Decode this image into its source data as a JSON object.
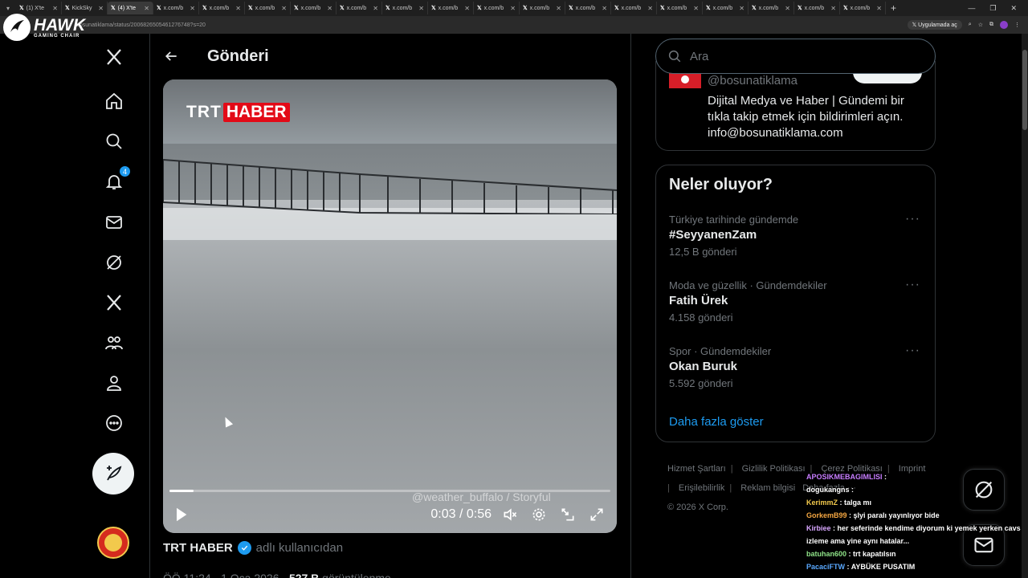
{
  "browser": {
    "tabs": [
      {
        "label": "(1) X'te"
      },
      {
        "label": "KickSky"
      },
      {
        "label": "(4) X'te",
        "active": true
      },
      {
        "label": "x.com/b"
      },
      {
        "label": "x.com/b"
      },
      {
        "label": "x.com/b"
      },
      {
        "label": "x.com/b"
      },
      {
        "label": "x.com/b"
      },
      {
        "label": "x.com/b"
      },
      {
        "label": "x.com/b"
      },
      {
        "label": "x.com/b"
      },
      {
        "label": "x.com/b"
      },
      {
        "label": "x.com/b"
      },
      {
        "label": "x.com/b"
      },
      {
        "label": "x.com/b"
      },
      {
        "label": "x.com/b"
      },
      {
        "label": "x.com/b"
      },
      {
        "label": "x.com/b"
      },
      {
        "label": "x.com/b"
      }
    ],
    "url": "bosunatiklama/status/2006826505461276748?s=20",
    "app_mode_label": "Uygulamada aç"
  },
  "overlay": {
    "brand": "HAWK",
    "brand_sub": "GAMING CHAIR"
  },
  "nav": {
    "notification_count": "4",
    "icons": [
      "x-logo-icon",
      "home-icon",
      "search-icon",
      "bell-icon",
      "mail-icon",
      "grok-icon",
      "x-premium-icon",
      "communities-icon",
      "profile-icon",
      "more-icon"
    ]
  },
  "main": {
    "title": "Gönderi",
    "video": {
      "logo_trt": "TRT",
      "logo_haber": "HABER",
      "watermark": "@weather_buffalo / Storyful",
      "time": "0:03 / 0:56",
      "progress": 0.054
    },
    "byline": {
      "name": "TRT HABER",
      "suffix": "adlı kullanıcıdan"
    },
    "timestamp_partial": "ÖÖ 11:24 · 1 Oca 2026 · ",
    "views_partial": "527 B",
    "views_suffix": " görüntülenme"
  },
  "sidebar": {
    "search_placeholder": "Ara",
    "profile": {
      "handle": "@bosunatiklama",
      "bio": "Dijital Medya ve Haber | Gündemi bir tıkla takip etmek için bildirimleri açın. info@bosunatiklama.com"
    },
    "trends_title": "Neler oluyor?",
    "trends": [
      {
        "meta": "Türkiye tarihinde gündemde",
        "name": "#SeyyanenZam",
        "count": "12,5 B gönderi"
      },
      {
        "meta": "Moda ve güzellik · Gündemdekiler",
        "name": "Fatih Ürek",
        "count": "4.158 gönderi"
      },
      {
        "meta": "Spor · Gündemdekiler",
        "name": "Okan Buruk",
        "count": "5.592 gönderi"
      }
    ],
    "show_more": "Daha fazla göster",
    "footer": {
      "terms": "Hizmet Şartları",
      "privacy": "Gizlilik Politikası",
      "cookies": "Çerez Politikası",
      "imprint": "Imprint",
      "accessibility": "Erişilebilirlik",
      "ads": "Reklam bilgisi",
      "more": "Daha fazla ···",
      "copyright": "© 2026 X Corp."
    }
  },
  "chat": [
    {
      "user": "APOSIKMEBAGIMLISI",
      "msg": "",
      "color": "#c77dff"
    },
    {
      "user": "dogukangns",
      "msg": "",
      "color": "#ffffff"
    },
    {
      "user": "KerimmZ",
      "msg": "talga mı",
      "color": "#f2c94c"
    },
    {
      "user": "GorkemB99",
      "msg": "şlyi paralı yayınlıyor bide",
      "color": "#f5a742"
    },
    {
      "user": "Kirbiee",
      "msg": "her seferinde kendime diyorum ki yemek yerken cavs izleme ama yine aynı hatalar...",
      "color": "#d8a7ff"
    },
    {
      "user": "batuhan600",
      "msg": "trt kapatılsın",
      "color": "#8fe388"
    },
    {
      "user": "PacaciFTW",
      "msg": "AYBÜKE PUSATIM",
      "color": "#5aa9ff"
    }
  ],
  "colors": {
    "accent": "#1d9bf0",
    "background": "#000000",
    "border": "#2f3336",
    "trt_red": "#e30a17"
  }
}
